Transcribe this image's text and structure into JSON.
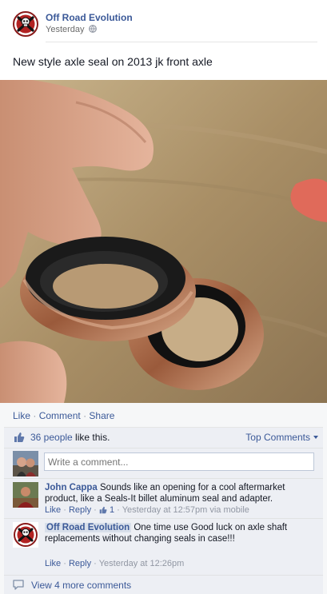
{
  "post": {
    "page_name": "Off Road Evolution",
    "timestamp": "Yesterday",
    "text": "New style axle seal on 2013 jk front axle"
  },
  "feedback": {
    "actions": [
      "Like",
      "Comment",
      "Share"
    ],
    "separator": "·",
    "likes_count": "36 people",
    "likes_suffix": " like this.",
    "sort_label": "Top Comments",
    "comment_placeholder": "Write a comment..."
  },
  "comments": [
    {
      "author": "John Cappa",
      "text": "Sounds like an opening for a cool aftermarket product, like a Seals-It billet aluminum seal and adapter.",
      "like_label": "Like",
      "reply_label": "Reply",
      "like_count": "1",
      "time": "Yesterday at 12:57pm via mobile"
    },
    {
      "author": "Off Road Evolution",
      "text": "One time use Good luck on axle shaft replacements without changing seals in case!!!",
      "like_label": "Like",
      "reply_label": "Reply",
      "time": "Yesterday at 12:26pm"
    }
  ],
  "more_comments": "View 4 more comments",
  "icons": {
    "globe": "globe-icon",
    "like": "thumbs-up-icon",
    "comment_bubble": "comment-bubble-icon"
  },
  "colors": {
    "link": "#3b5998",
    "feedback_bg": "#f6f7f8",
    "row_bg": "#edeff4"
  }
}
